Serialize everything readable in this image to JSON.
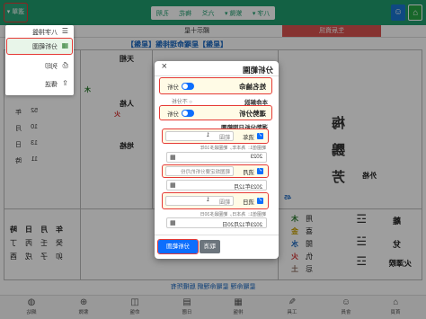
{
  "topbar": {
    "menu_button": "選單",
    "nav_items": [
      "八字 ▾",
      "紫微 ▾",
      "六爻",
      "梅花",
      "孔明"
    ],
    "home_icon": "house-icon",
    "user_icon": "user-icon"
  },
  "tabs": {
    "birth_info": "生辰資訊",
    "ten_stars": "顯示十星"
  },
  "menu": {
    "header": "八字排盤",
    "items": [
      "分析範圍",
      "列印",
      "傳送"
    ]
  },
  "chart": {
    "title": "【星盤】星曜命理排盤【星盤】",
    "grid_labels": [
      "天相",
      "人格",
      "地格",
      "外格"
    ],
    "name_chars": [
      "梅",
      "鸚",
      "芳"
    ],
    "element_marks": [
      "木",
      "火"
    ],
    "score": "45",
    "birth_numbers": [
      [
        "52",
        "年"
      ],
      [
        "10",
        "月"
      ],
      [
        "13",
        "日"
      ],
      [
        "11",
        "時"
      ]
    ],
    "pillars": {
      "headers": [
        "年",
        "月",
        "日",
        "時"
      ],
      "stems": [
        "癸",
        "壬",
        "丙",
        "丁"
      ],
      "branches": [
        "卯",
        "子",
        "戌",
        "酉"
      ]
    },
    "five_elements": [
      {
        "role": "用",
        "element": "木",
        "color": "#2e7d32"
      },
      {
        "role": "喜",
        "element": "金",
        "color": "#c9a100"
      },
      {
        "role": "閒",
        "element": "水",
        "color": "#1565c0"
      },
      {
        "role": "仇",
        "element": "火",
        "color": "#d32f2f"
      },
      {
        "role": "忌",
        "element": "土",
        "color": "#8d6e63"
      }
    ],
    "hexagram": {
      "upper": "離",
      "lower": "兌",
      "name": "火澤睽",
      "symbols": [
        "☲",
        "☱",
        "☲"
      ]
    }
  },
  "modal": {
    "title": "分析範圍",
    "close": "×",
    "name_analysis": {
      "label": "姓名論命",
      "switch_label": "分析",
      "on": true
    },
    "natal_section": {
      "label": "本命解說",
      "option": "不分析"
    },
    "fortune_analysis": {
      "label": "運勢分析",
      "switch_label": "分析",
      "on": true
    },
    "date_range_label": "運勢分析日期範圍",
    "year": {
      "label": "流年",
      "prefix": "範圍",
      "value": "1",
      "hint": "範圍值1：為本年，範圍最多10年",
      "date": "2023"
    },
    "month": {
      "label": "流月",
      "placeholder": "範圍設定要分析的月份",
      "date": "2023年12月"
    },
    "day": {
      "label": "流日",
      "prefix": "範圍",
      "value": "1",
      "hint": "範圍值1：為本日，範圍最多30日",
      "date": "2023年12月20日"
    },
    "buttons": {
      "cancel": "取消",
      "submit": "分析範圍"
    }
  },
  "footer": "星曜命理 星曜命理網 版權所有",
  "bottom_nav": [
    {
      "icon": "home-icon",
      "label": "首頁"
    },
    {
      "icon": "user-icon",
      "label": "會員"
    },
    {
      "icon": "pencil-icon",
      "label": "工具"
    },
    {
      "icon": "grid-icon",
      "label": "排盤"
    },
    {
      "icon": "calendar-icon",
      "label": "日曆"
    },
    {
      "icon": "chart-icon",
      "label": "命盤"
    },
    {
      "icon": "plus-circle-icon",
      "label": "紫微"
    },
    {
      "icon": "globe-icon",
      "label": "網站"
    }
  ],
  "colors": {
    "topbar": "#1f9d6f",
    "primary": "#0d6efd",
    "highlight": "#e53935",
    "tab_active": "#d9534f"
  }
}
